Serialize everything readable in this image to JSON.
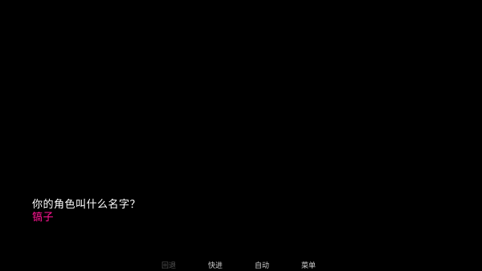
{
  "dialogue": {
    "prompt": "你的角色叫什么名字？",
    "input_value": "镐子"
  },
  "quick_menu": {
    "back": "回退",
    "skip": "快进",
    "auto": "自动",
    "menu": "菜单"
  },
  "colors": {
    "background": "#000000",
    "prompt_text": "#ffffff",
    "input_text": "#ff1493",
    "menu_text": "#cfcfcf",
    "menu_disabled": "#555555"
  }
}
